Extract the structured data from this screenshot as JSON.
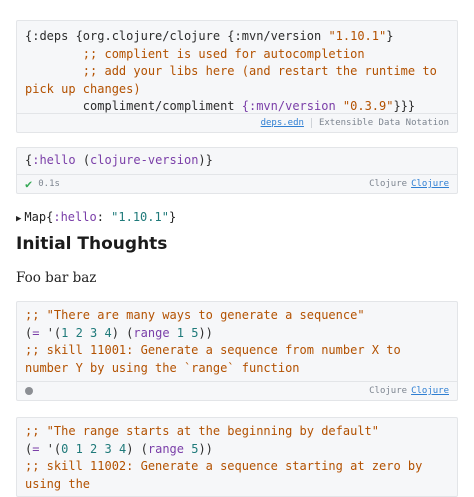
{
  "deps_cell": {
    "line1_open": "{:deps {org.clojure/clojure {:mvn/version ",
    "line1_version": "\"1.10.1\"",
    "line1_close": "}",
    "comment1": "        ;; complient is used for autocompletion",
    "comment2": "        ;; add your libs here (and restart the runtime to pick up changes)",
    "line4_lib": "        compliment/compliment ",
    "line4_key": "{:mvn/version ",
    "line4_version": "\"0.3.9\"",
    "line4_close": "}}}",
    "footer_file": "deps.edn",
    "footer_format": "Extensible Data Notation"
  },
  "hello_cell": {
    "code_open": "{",
    "code_key": ":hello",
    "code_mid": " (",
    "code_fn": "clojure-version",
    "code_close": ")}",
    "status_time": "0.1s",
    "lang_label": "Clojure",
    "lang_link": "Clojure"
  },
  "result": {
    "prefix": "Map",
    "open": "{",
    "key": ":hello",
    "colon_space": ": ",
    "value": "\"1.10.1\"",
    "close": "}"
  },
  "heading": "Initial Thoughts",
  "paragraph": "Foo bar baz",
  "seq_cell": {
    "comment1": ";; \"There are many ways to generate a sequence\"",
    "code2_open": "(",
    "code2_eq": "=",
    "code2_quote": " '(",
    "code2_nums": "1 2 3 4",
    "code2_mid": ") (",
    "code2_fn": "range",
    "code2_args": " 1 5",
    "code2_close": "))",
    "comment3": ";; skill 11001: Generate a sequence from number X to number Y by using the `range` function",
    "lang_label": "Clojure",
    "lang_link": "Clojure"
  },
  "range_cell": {
    "comment1": ";; \"The range starts at the beginning by default\"",
    "code2_open": "(",
    "code2_eq": "=",
    "code2_quote": " '(",
    "code2_nums": "0 1 2 3 4",
    "code2_mid": ") (",
    "code2_fn": "range",
    "code2_args": " 5",
    "code2_close": "))",
    "comment3": ";; skill 11002: Generate a sequence starting at zero by using the"
  },
  "colors": {
    "keyword": "#7a3ea8",
    "string": "#b35100",
    "number": "#1f7a7a",
    "success": "#36a957",
    "link": "#2f7fd3"
  }
}
